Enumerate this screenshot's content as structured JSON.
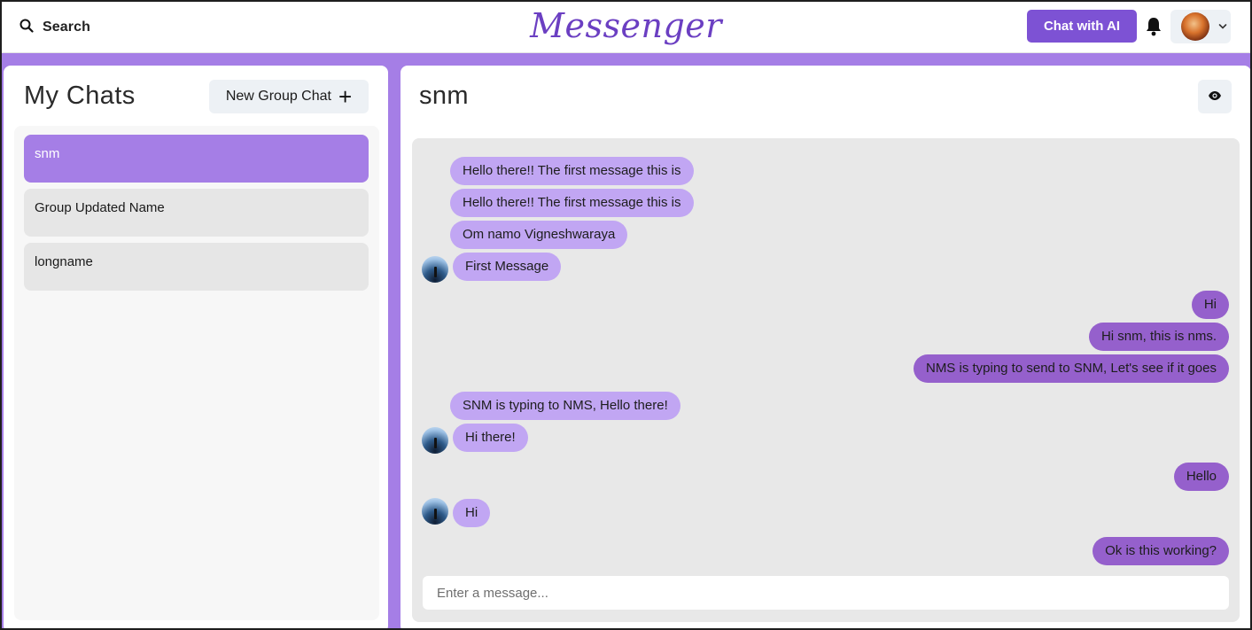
{
  "topbar": {
    "search_label": "Search",
    "logo": "Messenger",
    "chat_ai_label": "Chat with AI"
  },
  "left": {
    "title": "My Chats",
    "new_group_label": "New Group Chat",
    "new_group_icon": "+",
    "chats": [
      {
        "name": "snm",
        "active": true
      },
      {
        "name": "Group Updated Name",
        "active": false
      },
      {
        "name": "longname",
        "active": false
      }
    ]
  },
  "right": {
    "chat_name": "snm",
    "messages": [
      {
        "text": "Hello there!! The first message this is",
        "from": "other"
      },
      {
        "text": "Hello there!! The first message this is",
        "from": "other"
      },
      {
        "text": "Om namo Vigneshwaraya",
        "from": "other"
      },
      {
        "text": "First Message",
        "from": "other",
        "avatar": true
      },
      {
        "text": "Hi",
        "from": "me"
      },
      {
        "text": "Hi snm, this is nms.",
        "from": "me"
      },
      {
        "text": "NMS is typing to send to SNM, Let's see if it goes",
        "from": "me"
      },
      {
        "text": "SNM is typing to NMS, Hello there!",
        "from": "other"
      },
      {
        "text": "Hi there!",
        "from": "other",
        "avatar": true
      },
      {
        "text": "Hello",
        "from": "me"
      },
      {
        "text": "Hi",
        "from": "other",
        "avatar": true
      },
      {
        "text": "Ok is this working?",
        "from": "me"
      }
    ],
    "input_placeholder": "Enter a message..."
  },
  "colors": {
    "accent": "#a57ee6",
    "button": "#7d52d4",
    "bubble_incoming": "#c1a6f3",
    "bubble_outgoing": "#9560cc",
    "message_area": "#e8e8e8"
  },
  "icons": [
    "search-icon",
    "bell-icon",
    "chevron-down-icon",
    "eye-icon",
    "plus-icon"
  ]
}
